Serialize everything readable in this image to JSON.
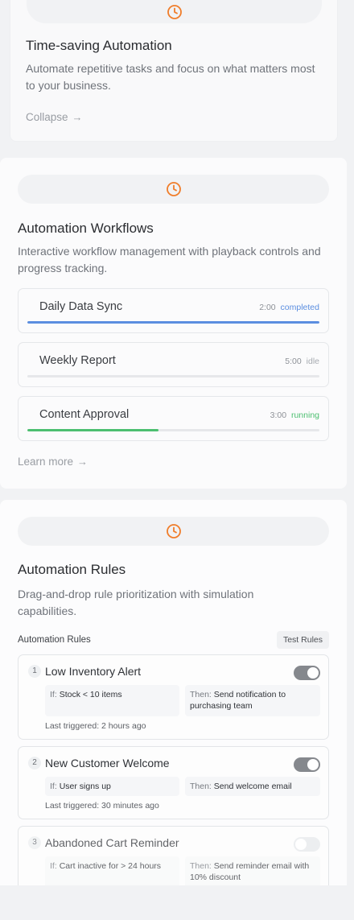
{
  "cards": [
    {
      "title": "Time-saving Automation",
      "description": "Automate repetitive tasks and focus on what matters most to your business.",
      "link": "Collapse",
      "icon": "clock-icon"
    },
    {
      "title": "Automation Workflows",
      "description": "Interactive workflow management with playback controls and progress tracking.",
      "link": "Learn more",
      "icon": "clock-icon"
    },
    {
      "title": "Automation Rules",
      "description": "Drag-and-drop rule prioritization with simulation capabilities.",
      "icon": "clock-icon"
    }
  ],
  "workflows": [
    {
      "name": "Daily Data Sync",
      "duration": "2:00",
      "status": "completed",
      "progress": 1.0
    },
    {
      "name": "Weekly Report",
      "duration": "5:00",
      "status": "idle",
      "progress": 0.0
    },
    {
      "name": "Content Approval",
      "duration": "3:00",
      "status": "running",
      "progress": 0.45
    }
  ],
  "rules_panel": {
    "label": "Automation Rules",
    "test_button": "Test Rules"
  },
  "rules": [
    {
      "number": "1",
      "name": "Low Inventory Alert",
      "enabled": true,
      "if_prefix": "If:",
      "condition": "Stock < 10 items",
      "then_prefix": "Then:",
      "action": "Send notification to purchasing team",
      "last_triggered": "Last triggered: 2 hours ago"
    },
    {
      "number": "2",
      "name": "New Customer Welcome",
      "enabled": true,
      "if_prefix": "If:",
      "condition": "User signs up",
      "then_prefix": "Then:",
      "action": "Send welcome email",
      "last_triggered": "Last triggered: 30 minutes ago"
    },
    {
      "number": "3",
      "name": "Abandoned Cart Reminder",
      "enabled": false,
      "if_prefix": "If:",
      "condition": "Cart inactive for > 24 hours",
      "then_prefix": "Then:",
      "action": "Send reminder email with 10% discount"
    }
  ],
  "colors": {
    "accent": "#f07d2a",
    "completed": "#5b8ee0",
    "running": "#4cbf70",
    "idle": "#a7abb1"
  }
}
